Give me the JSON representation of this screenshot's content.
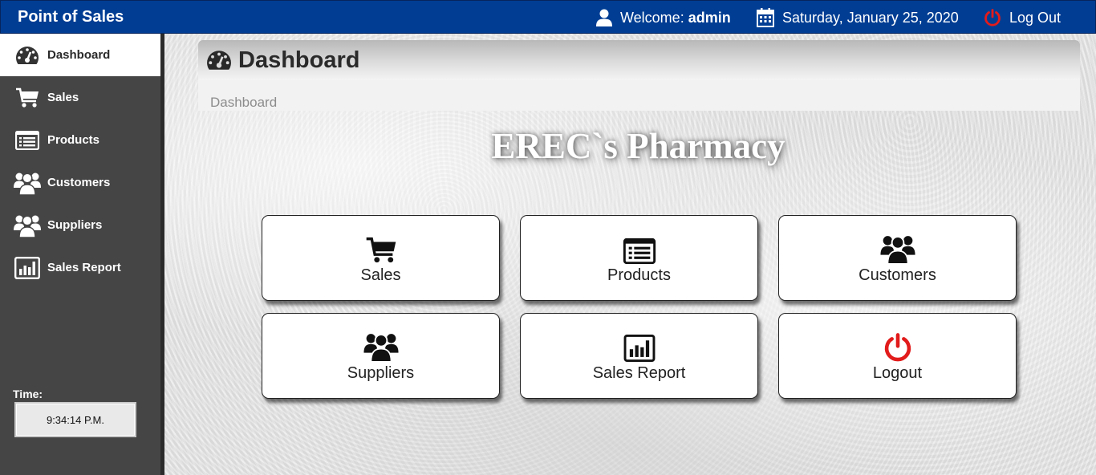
{
  "header": {
    "app_title": "Point of Sales",
    "welcome_prefix": "Welcome:",
    "username": "admin",
    "date": "Saturday, January 25, 2020",
    "logout_label": "Log Out",
    "icons": [
      "user-icon",
      "calendar-icon",
      "power-icon"
    ]
  },
  "sidebar": {
    "items": [
      {
        "label": "Dashboard",
        "icon": "dashboard-icon",
        "active": true
      },
      {
        "label": "Sales",
        "icon": "cart-icon"
      },
      {
        "label": "Products",
        "icon": "list-icon"
      },
      {
        "label": "Customers",
        "icon": "users-icon"
      },
      {
        "label": "Suppliers",
        "icon": "users-icon"
      },
      {
        "label": "Sales Report",
        "icon": "bar-chart-icon"
      }
    ],
    "time_label": "Time:",
    "time_value": "9:34:14 P.M."
  },
  "main": {
    "title": "Dashboard",
    "breadcrumb": "Dashboard",
    "brand": "EREC`s Pharmacy",
    "tiles": [
      {
        "label": "Sales",
        "icon": "cart-icon"
      },
      {
        "label": "Products",
        "icon": "list-icon"
      },
      {
        "label": "Customers",
        "icon": "users-icon"
      },
      {
        "label": "Suppliers",
        "icon": "users-icon"
      },
      {
        "label": "Sales Report",
        "icon": "bar-chart-icon"
      },
      {
        "label": "Logout",
        "icon": "power-icon"
      }
    ]
  },
  "colors": {
    "header_bg": "#003d93",
    "sidebar_bg": "#454545",
    "logout_red": "#e21b1b"
  }
}
